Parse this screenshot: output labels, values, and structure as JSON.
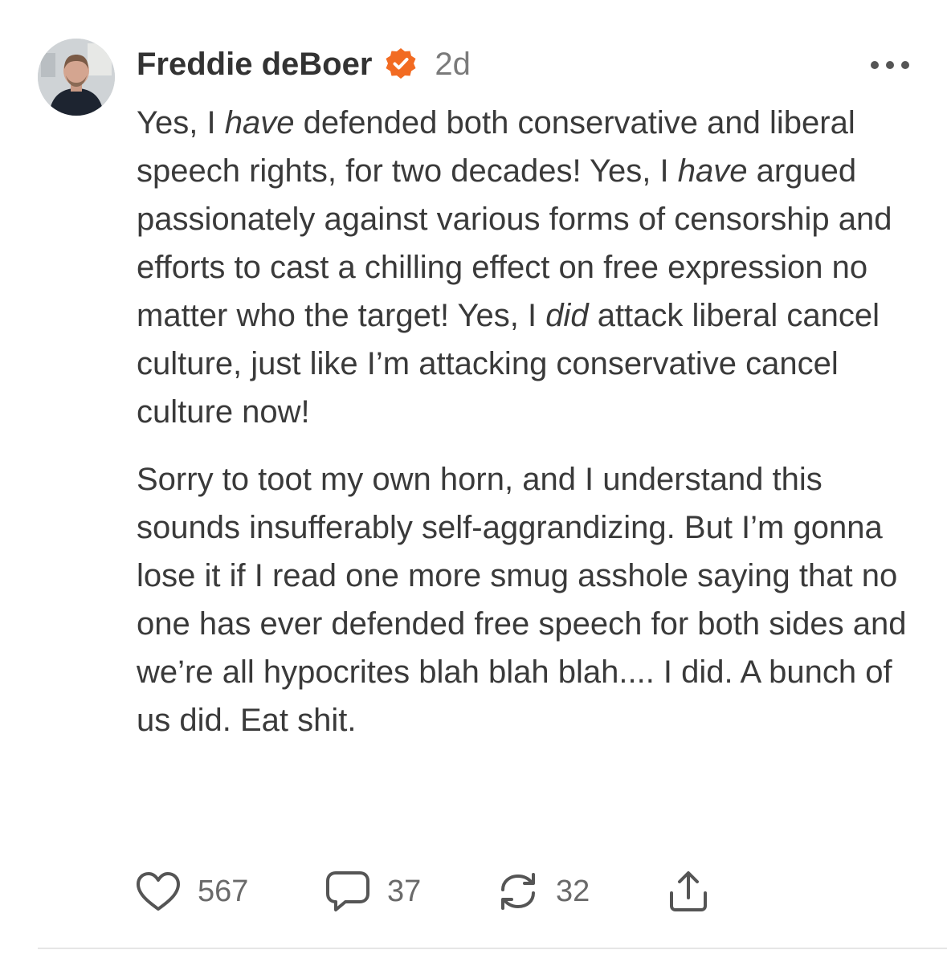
{
  "post": {
    "author": {
      "name": "Freddie deBoer",
      "verified_badge": "verified-check-icon",
      "avatar": "avatar-photo"
    },
    "timestamp": "2d",
    "menu_icon": "more-horizontal-icon",
    "paragraphs": [
      [
        {
          "t": "Yes, I "
        },
        {
          "t": "have",
          "em": true
        },
        {
          "t": " defended both conservative and liberal speech rights, for two decades! Yes, I "
        },
        {
          "t": "have",
          "em": true
        },
        {
          "t": " argued passionately against various forms of censorship and efforts to cast a chilling effect on free expression no matter who the target! Yes, I "
        },
        {
          "t": "did",
          "em": true
        },
        {
          "t": " attack liberal cancel culture, just like I’m attacking conservative cancel culture now!"
        }
      ],
      [
        {
          "t": "Sorry to toot my own horn, and I understand this sounds insufferably self-aggrandizing. But I’m gonna lose it if I read one more smug asshole saying that no one has ever defended free speech for both sides and we’re all hypocrites blah blah blah.... I did. A bunch of us did. Eat shit."
        }
      ]
    ],
    "actions": {
      "like": {
        "icon": "heart-icon",
        "count": "567"
      },
      "comment": {
        "icon": "comment-bubble-icon",
        "count": "37"
      },
      "restack": {
        "icon": "restack-icon",
        "count": "32"
      },
      "share": {
        "icon": "share-icon"
      }
    },
    "colors": {
      "verified_badge": "#F26B22",
      "text": "#3A3A3A",
      "muted": "#7A7A7A"
    }
  }
}
